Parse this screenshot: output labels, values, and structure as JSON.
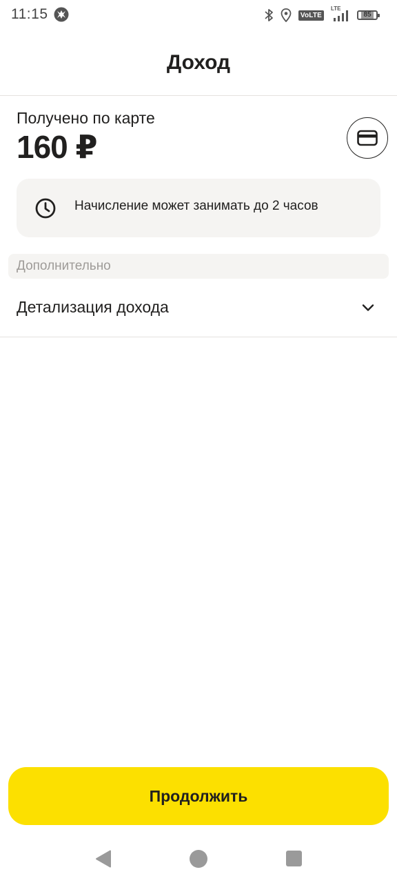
{
  "status_bar": {
    "time": "11:15",
    "network_badge": "VoLTE",
    "network_type": "LTE",
    "battery_level": "85",
    "icons": [
      "app-notification-icon",
      "bluetooth-icon",
      "location-icon",
      "signal-icon",
      "battery-icon"
    ]
  },
  "header": {
    "title": "Доход"
  },
  "income": {
    "label": "Получено по карте",
    "amount": "160 ₽",
    "card_icon": "credit-card-icon"
  },
  "info_banner": {
    "icon": "clock-icon",
    "text": "Начисление может занимать до 2 часов"
  },
  "additional_section": {
    "title": "Дополнительно",
    "rows": [
      {
        "label": "Детализация дохода",
        "icon": "chevron-down-icon"
      }
    ]
  },
  "actions": {
    "continue_label": "Продолжить"
  },
  "colors": {
    "accent": "#fce000",
    "text_primary": "#21201f",
    "text_secondary": "#9e9b98",
    "surface": "#f5f4f2"
  },
  "nav_bar": {
    "icons": [
      "back-icon",
      "home-icon",
      "recents-icon"
    ]
  }
}
